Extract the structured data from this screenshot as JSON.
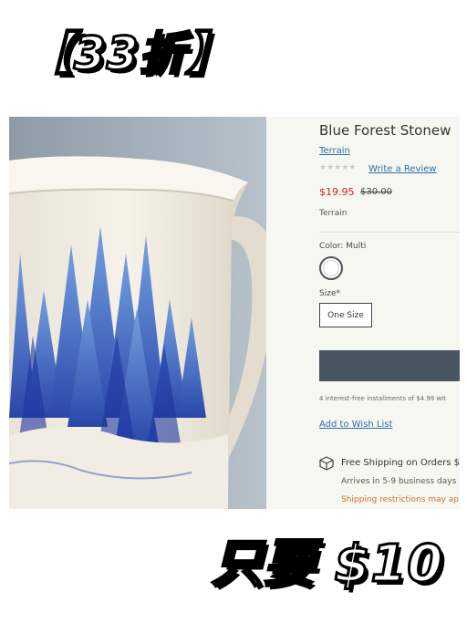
{
  "promo": {
    "top_text": "【33折】",
    "bottom_text": "只要 $10"
  },
  "product": {
    "title": "Blue Forest Stonew",
    "brand_link": "Terrain",
    "rating_stars": "★★★★★",
    "review_link": "Write a Review",
    "sale_price": "$19.95",
    "original_price": "$30.00",
    "vendor": "Terrain",
    "color_label": "Color: Multi",
    "size_label": "Size*",
    "size_option": "One Size",
    "installments": "4 interest-free installments of $4.99 wit",
    "wishlist_link": "Add to Wish List",
    "shipping": {
      "title": "Free Shipping on Orders $5",
      "arrives": "Arrives in 5-9 business days",
      "restrictions": "Shipping restrictions may ap"
    }
  },
  "colors": {
    "price_red": "#d21f2b",
    "link_blue": "#2a6fa8",
    "cart_button": "#4a5563",
    "shipping_warning": "#c7742f"
  },
  "icons": {
    "shipping": "package-icon",
    "color_swatch": "swatch-circle"
  }
}
